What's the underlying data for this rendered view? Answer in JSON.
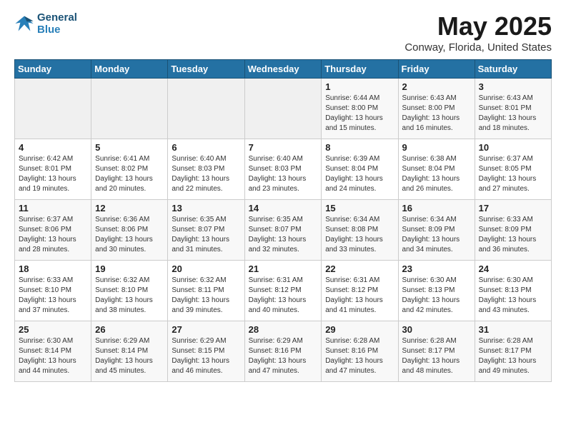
{
  "header": {
    "logo_line1": "General",
    "logo_line2": "Blue",
    "month": "May 2025",
    "location": "Conway, Florida, United States"
  },
  "weekdays": [
    "Sunday",
    "Monday",
    "Tuesday",
    "Wednesday",
    "Thursday",
    "Friday",
    "Saturday"
  ],
  "weeks": [
    [
      {
        "day": "",
        "info": ""
      },
      {
        "day": "",
        "info": ""
      },
      {
        "day": "",
        "info": ""
      },
      {
        "day": "",
        "info": ""
      },
      {
        "day": "1",
        "info": "Sunrise: 6:44 AM\nSunset: 8:00 PM\nDaylight: 13 hours and 15 minutes."
      },
      {
        "day": "2",
        "info": "Sunrise: 6:43 AM\nSunset: 8:00 PM\nDaylight: 13 hours and 16 minutes."
      },
      {
        "day": "3",
        "info": "Sunrise: 6:43 AM\nSunset: 8:01 PM\nDaylight: 13 hours and 18 minutes."
      }
    ],
    [
      {
        "day": "4",
        "info": "Sunrise: 6:42 AM\nSunset: 8:01 PM\nDaylight: 13 hours and 19 minutes."
      },
      {
        "day": "5",
        "info": "Sunrise: 6:41 AM\nSunset: 8:02 PM\nDaylight: 13 hours and 20 minutes."
      },
      {
        "day": "6",
        "info": "Sunrise: 6:40 AM\nSunset: 8:03 PM\nDaylight: 13 hours and 22 minutes."
      },
      {
        "day": "7",
        "info": "Sunrise: 6:40 AM\nSunset: 8:03 PM\nDaylight: 13 hours and 23 minutes."
      },
      {
        "day": "8",
        "info": "Sunrise: 6:39 AM\nSunset: 8:04 PM\nDaylight: 13 hours and 24 minutes."
      },
      {
        "day": "9",
        "info": "Sunrise: 6:38 AM\nSunset: 8:04 PM\nDaylight: 13 hours and 26 minutes."
      },
      {
        "day": "10",
        "info": "Sunrise: 6:37 AM\nSunset: 8:05 PM\nDaylight: 13 hours and 27 minutes."
      }
    ],
    [
      {
        "day": "11",
        "info": "Sunrise: 6:37 AM\nSunset: 8:06 PM\nDaylight: 13 hours and 28 minutes."
      },
      {
        "day": "12",
        "info": "Sunrise: 6:36 AM\nSunset: 8:06 PM\nDaylight: 13 hours and 30 minutes."
      },
      {
        "day": "13",
        "info": "Sunrise: 6:35 AM\nSunset: 8:07 PM\nDaylight: 13 hours and 31 minutes."
      },
      {
        "day": "14",
        "info": "Sunrise: 6:35 AM\nSunset: 8:07 PM\nDaylight: 13 hours and 32 minutes."
      },
      {
        "day": "15",
        "info": "Sunrise: 6:34 AM\nSunset: 8:08 PM\nDaylight: 13 hours and 33 minutes."
      },
      {
        "day": "16",
        "info": "Sunrise: 6:34 AM\nSunset: 8:09 PM\nDaylight: 13 hours and 34 minutes."
      },
      {
        "day": "17",
        "info": "Sunrise: 6:33 AM\nSunset: 8:09 PM\nDaylight: 13 hours and 36 minutes."
      }
    ],
    [
      {
        "day": "18",
        "info": "Sunrise: 6:33 AM\nSunset: 8:10 PM\nDaylight: 13 hours and 37 minutes."
      },
      {
        "day": "19",
        "info": "Sunrise: 6:32 AM\nSunset: 8:10 PM\nDaylight: 13 hours and 38 minutes."
      },
      {
        "day": "20",
        "info": "Sunrise: 6:32 AM\nSunset: 8:11 PM\nDaylight: 13 hours and 39 minutes."
      },
      {
        "day": "21",
        "info": "Sunrise: 6:31 AM\nSunset: 8:12 PM\nDaylight: 13 hours and 40 minutes."
      },
      {
        "day": "22",
        "info": "Sunrise: 6:31 AM\nSunset: 8:12 PM\nDaylight: 13 hours and 41 minutes."
      },
      {
        "day": "23",
        "info": "Sunrise: 6:30 AM\nSunset: 8:13 PM\nDaylight: 13 hours and 42 minutes."
      },
      {
        "day": "24",
        "info": "Sunrise: 6:30 AM\nSunset: 8:13 PM\nDaylight: 13 hours and 43 minutes."
      }
    ],
    [
      {
        "day": "25",
        "info": "Sunrise: 6:30 AM\nSunset: 8:14 PM\nDaylight: 13 hours and 44 minutes."
      },
      {
        "day": "26",
        "info": "Sunrise: 6:29 AM\nSunset: 8:14 PM\nDaylight: 13 hours and 45 minutes."
      },
      {
        "day": "27",
        "info": "Sunrise: 6:29 AM\nSunset: 8:15 PM\nDaylight: 13 hours and 46 minutes."
      },
      {
        "day": "28",
        "info": "Sunrise: 6:29 AM\nSunset: 8:16 PM\nDaylight: 13 hours and 47 minutes."
      },
      {
        "day": "29",
        "info": "Sunrise: 6:28 AM\nSunset: 8:16 PM\nDaylight: 13 hours and 47 minutes."
      },
      {
        "day": "30",
        "info": "Sunrise: 6:28 AM\nSunset: 8:17 PM\nDaylight: 13 hours and 48 minutes."
      },
      {
        "day": "31",
        "info": "Sunrise: 6:28 AM\nSunset: 8:17 PM\nDaylight: 13 hours and 49 minutes."
      }
    ]
  ]
}
